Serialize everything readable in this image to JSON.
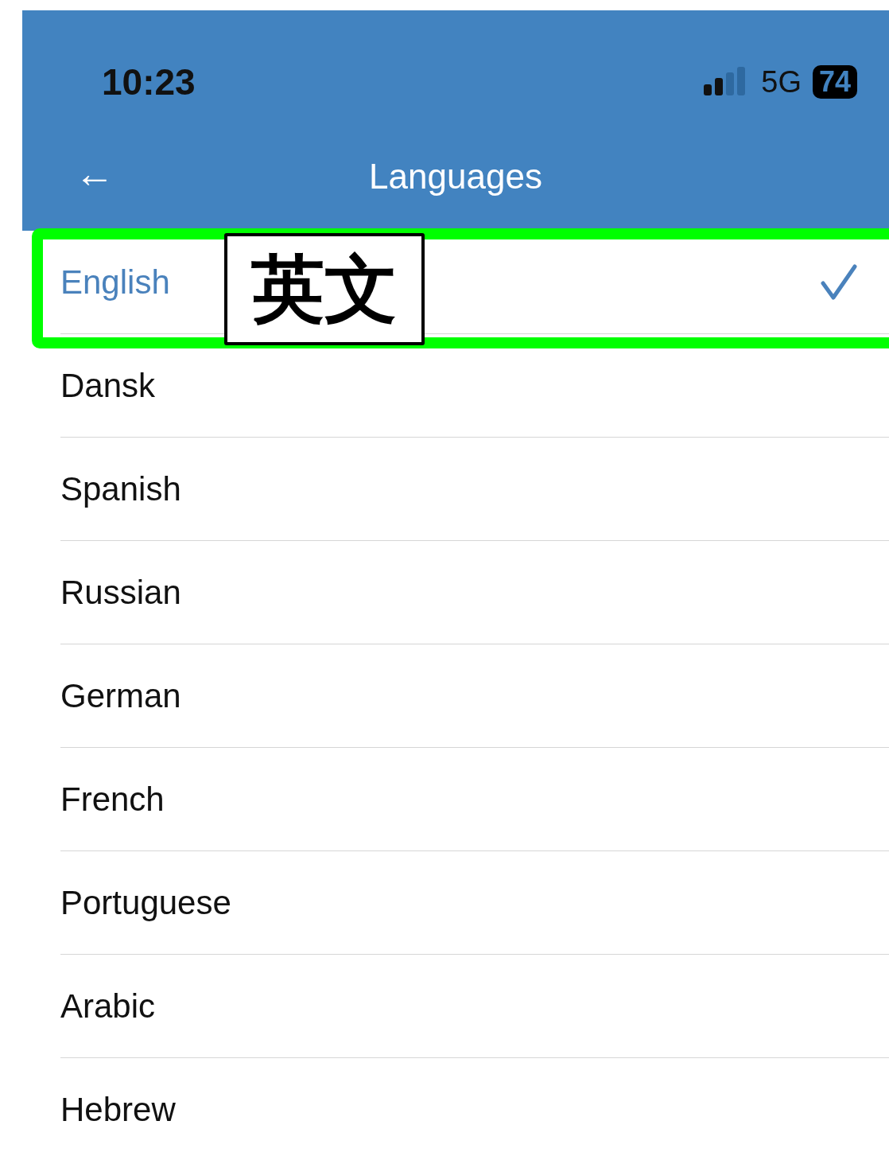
{
  "status_bar": {
    "time": "10:23",
    "network": "5G",
    "battery": "74"
  },
  "header": {
    "back": "←",
    "title": "Languages"
  },
  "languages": [
    {
      "label": "English",
      "selected": true
    },
    {
      "label": "Dansk",
      "selected": false
    },
    {
      "label": "Spanish",
      "selected": false
    },
    {
      "label": "Russian",
      "selected": false
    },
    {
      "label": "German",
      "selected": false
    },
    {
      "label": "French",
      "selected": false
    },
    {
      "label": "Portuguese",
      "selected": false
    },
    {
      "label": "Arabic",
      "selected": false
    },
    {
      "label": "Hebrew",
      "selected": false
    }
  ],
  "annotation": {
    "label": "英文",
    "color": "#00ff00"
  }
}
